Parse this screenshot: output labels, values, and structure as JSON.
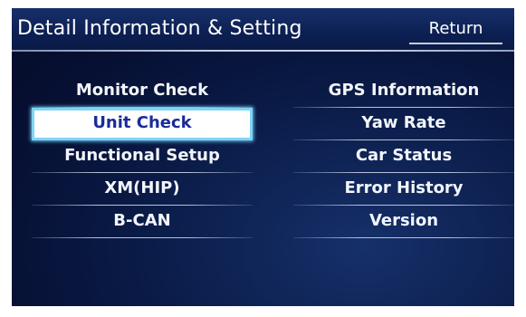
{
  "header": {
    "title": "Detail Information & Setting",
    "return_label": "Return"
  },
  "menu": {
    "left": [
      {
        "label": "Monitor Check"
      },
      {
        "label": "Unit Check",
        "selected": true
      },
      {
        "label": "Functional Setup"
      },
      {
        "label": "XM(HIP)"
      },
      {
        "label": "B-CAN"
      }
    ],
    "right": [
      {
        "label": "GPS Information"
      },
      {
        "label": "Yaw Rate"
      },
      {
        "label": "Car Status"
      },
      {
        "label": "Error History"
      },
      {
        "label": "Version"
      }
    ]
  },
  "colors": {
    "background": "#0a1b47",
    "selection_outline": "#7fd4f6",
    "selected_text": "#1a2c9a",
    "text": "#ffffff"
  }
}
